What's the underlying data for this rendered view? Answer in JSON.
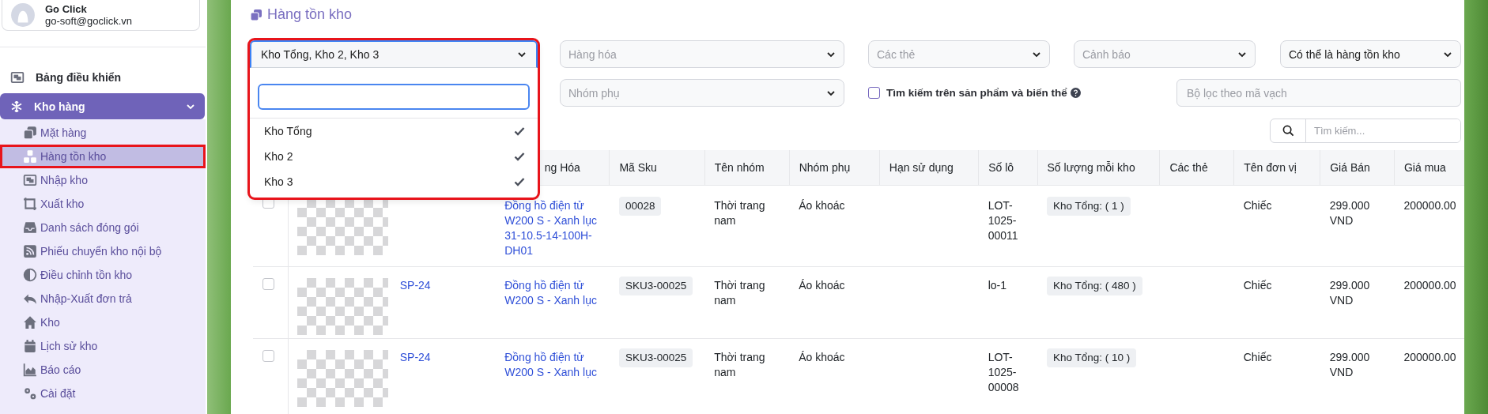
{
  "sidebar": {
    "user": {
      "name": "Go Click",
      "email": "go-soft@goclick.vn"
    },
    "top_items": [
      {
        "label": "Bảng điều khiển"
      }
    ],
    "group": {
      "label": "Kho hàng",
      "expanded": true,
      "children": [
        {
          "label": "Mặt hàng",
          "selected": false,
          "highlighted": false
        },
        {
          "label": "Hàng tồn kho",
          "selected": true,
          "highlighted": true
        },
        {
          "label": "Nhập kho",
          "selected": false,
          "highlighted": false
        },
        {
          "label": "Xuất kho",
          "selected": false,
          "highlighted": false
        },
        {
          "label": "Danh sách đóng gói",
          "selected": false,
          "highlighted": false
        },
        {
          "label": "Phiếu chuyển kho nội bộ",
          "selected": false,
          "highlighted": false
        },
        {
          "label": "Điều chỉnh tồn kho",
          "selected": false,
          "highlighted": false
        },
        {
          "label": "Nhập-Xuất đơn trả",
          "selected": false,
          "highlighted": false
        },
        {
          "label": "Kho",
          "selected": false,
          "highlighted": false
        },
        {
          "label": "Lịch sử kho",
          "selected": false,
          "highlighted": false
        },
        {
          "label": "Báo cáo",
          "selected": false,
          "highlighted": false
        },
        {
          "label": "Cài đặt",
          "selected": false,
          "highlighted": false
        }
      ]
    }
  },
  "page": {
    "title": "Hàng tồn kho"
  },
  "filters": {
    "warehouse": {
      "value": "Kho Tổng, Kho 2, Kho 3",
      "expanded": true,
      "highlighted": true,
      "options": [
        {
          "label": "Kho Tổng",
          "checked": true
        },
        {
          "label": "Kho 2",
          "checked": true
        },
        {
          "label": "Kho 3",
          "checked": true
        }
      ]
    },
    "selects": [
      {
        "placeholder": "Hàng hóa"
      },
      {
        "placeholder": "Các thẻ"
      },
      {
        "placeholder": "Cảnh báo"
      },
      {
        "value": "Có thể là hàng tồn kho"
      }
    ],
    "subgroup": {
      "placeholder": "Nhóm phụ"
    },
    "variant_search": {
      "label": "Tìm kiếm trên sản phẩm và biến thể",
      "checked": false
    },
    "barcode": {
      "placeholder": "Bộ lọc theo mã vạch"
    },
    "search": {
      "placeholder": "Tìm kiếm..."
    }
  },
  "table": {
    "columns": [
      "ng Hóa",
      "Mã Sku",
      "Tên nhóm",
      "Nhóm phụ",
      "Hạn sử dụng",
      "Số lô",
      "Số lượng mỗi kho",
      "Các thẻ",
      "Tên đơn vị",
      "Giá Bán",
      "Giá mua"
    ],
    "rows": [
      {
        "selected": false,
        "product": "Đồng hồ điện tử W200 S - Xanh lục 31-10.5-14-100H-DH01",
        "sku": "00028",
        "group": "Thời trang nam",
        "subgroup": "Áo khoác",
        "lot": "LOT-1025-00011",
        "stock": "Kho Tổng: ( 1 )",
        "unit": "Chiếc",
        "sale_price": "299.000 VND",
        "purchase_price": "200000.00"
      },
      {
        "selected": false,
        "code": "SP-24",
        "product": "Đồng hồ điện tử W200 S - Xanh lục",
        "sku": "SKU3-00025",
        "group": "Thời trang nam",
        "subgroup": "Áo khoác",
        "lot": "lo-1",
        "stock": "Kho Tổng: ( 480 )",
        "unit": "Chiếc",
        "sale_price": "299.000 VND",
        "purchase_price": "200000.00"
      },
      {
        "selected": false,
        "code": "SP-24",
        "product": "Đồng hồ điện tử W200 S - Xanh lục",
        "sku": "SKU3-00025",
        "group": "Thời trang nam",
        "subgroup": "Áo khoác",
        "lot": "LOT-1025-00008",
        "stock": "Kho Tổng: ( 10 )",
        "unit": "Chiếc",
        "sale_price": "299.000 VND",
        "purchase_price": "200000.00"
      }
    ]
  }
}
